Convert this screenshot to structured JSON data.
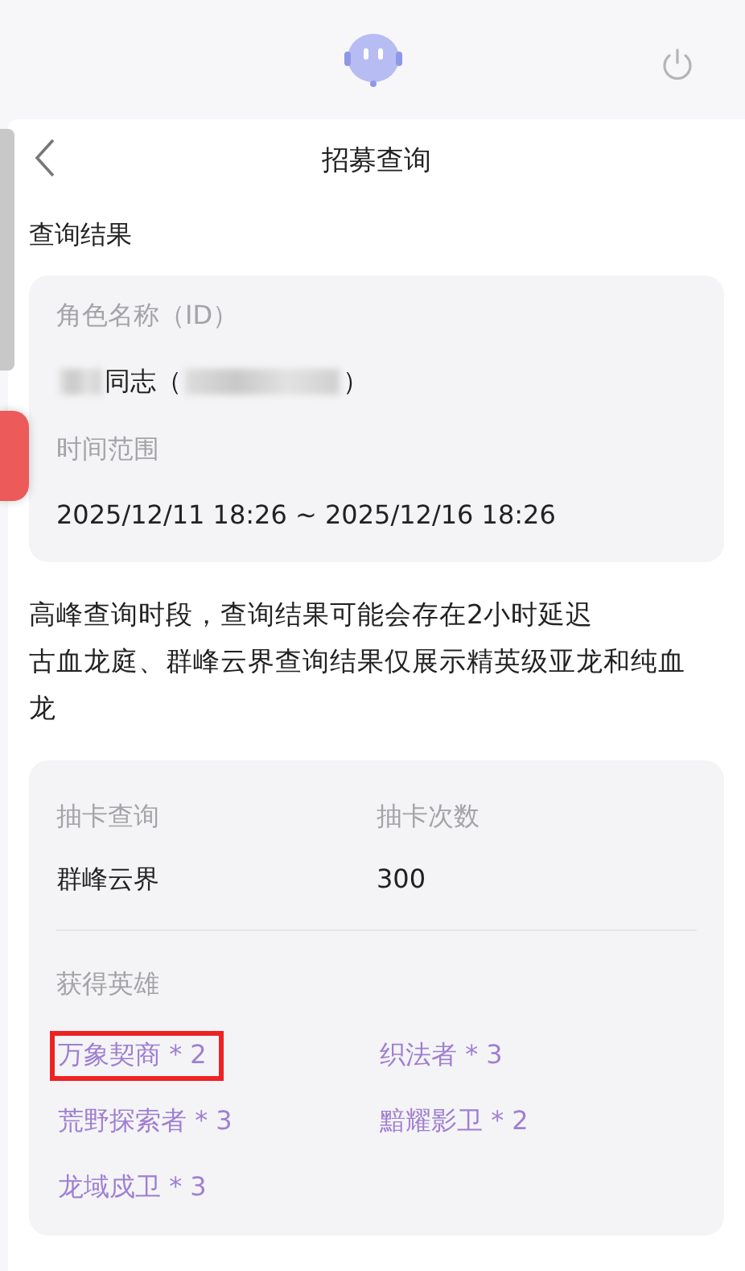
{
  "header": {
    "title": "招募查询"
  },
  "section_title": "查询结果",
  "query_card": {
    "fields": [
      {
        "label": "角色名称（ID）",
        "value_parts": [
          {
            "kind": "blur"
          },
          {
            "kind": "text",
            "text": "同志（"
          },
          {
            "kind": "longblur"
          },
          {
            "kind": "text",
            "text": "）"
          }
        ]
      },
      {
        "label": "时间范围",
        "value_parts": [
          {
            "kind": "text",
            "text": "2025/12/11 18:26 ~ 2025/12/16 18:26"
          }
        ]
      }
    ]
  },
  "notice": [
    "高峰查询时段，查询结果可能会存在2小时延迟",
    "古血龙庭、群峰云界查询结果仅展示精英级亚龙和纯血龙"
  ],
  "result_card": {
    "stats": [
      {
        "label": "抽卡查询",
        "value": "群峰云界"
      },
      {
        "label": "抽卡次数",
        "value": "300"
      }
    ],
    "heroes_label": "获得英雄",
    "heroes": [
      {
        "text": "万象契商 * 2",
        "highlighted": true
      },
      {
        "text": "织法者 * 3",
        "highlighted": false
      },
      {
        "text": "荒野探索者 * 3",
        "highlighted": false
      },
      {
        "text": "黯耀影卫 * 2",
        "highlighted": false
      },
      {
        "text": "龙域戍卫 * 3",
        "highlighted": false
      }
    ]
  }
}
